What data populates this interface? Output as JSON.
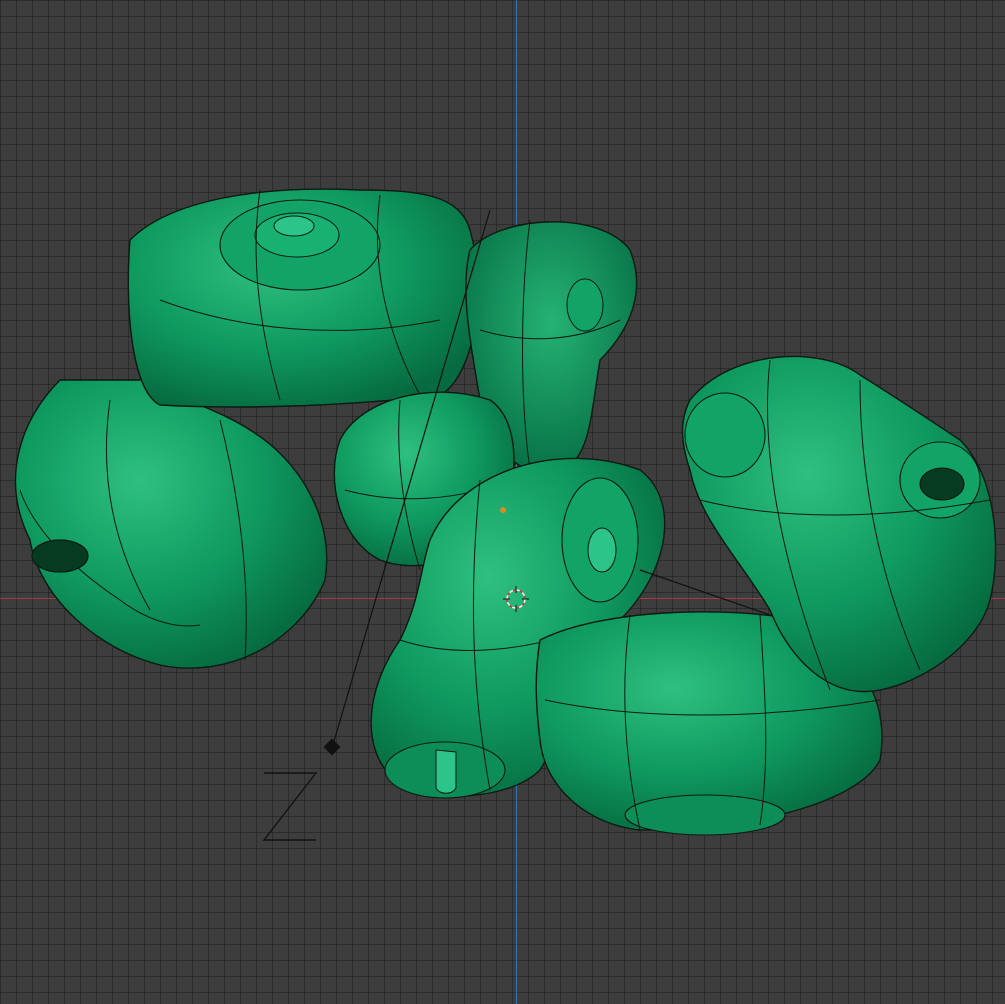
{
  "viewport": {
    "background": "#3d3d3d",
    "x_axis_color": "#a13c45",
    "y_axis_color": "#3d6fb3",
    "mesh_color": "#0f9a60",
    "wire_color": "#0c1a12"
  },
  "gizmo": {
    "axis_label": "Z",
    "light_icon": "light-lamp-icon",
    "cursor_icon": "3d-cursor-icon"
  }
}
